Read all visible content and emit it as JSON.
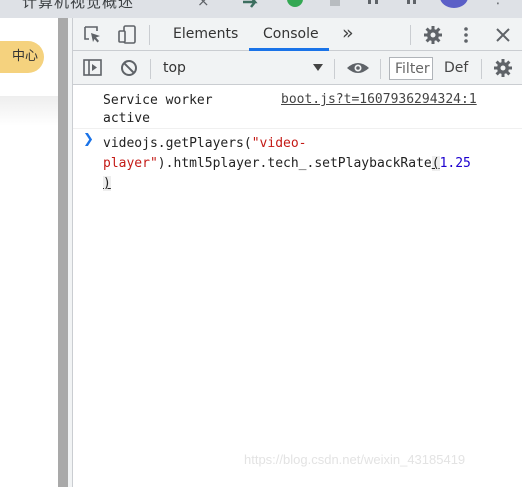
{
  "browser": {
    "tab_title": "计算机视觉概述",
    "tab_close": "×"
  },
  "page": {
    "center_button": "中心"
  },
  "devtools": {
    "tabs": [
      "Elements",
      "Console"
    ],
    "active_tab": "Console",
    "more_tabs": "»",
    "context": "top",
    "filter_placeholder": "Filter",
    "levels_label": "Def"
  },
  "console": {
    "log_message": "Service worker active",
    "log_source": "boot.js?t=1607936294324:1",
    "command_prefix": "videojs.getPlayers(",
    "command_string_part1": "\"video-",
    "command_string_part2": "player\"",
    "command_middle": ").html5player.tech_.setPlaybackRate",
    "command_open_paren": "(",
    "command_number": "1.25",
    "command_close_paren": ")"
  },
  "watermark": "https://blog.csdn.net/weixin_43185419",
  "colors": {
    "accent": "#1a73e8",
    "string": "#c41a16",
    "number": "#1c00cf",
    "button_bg": "#f5d27e"
  }
}
